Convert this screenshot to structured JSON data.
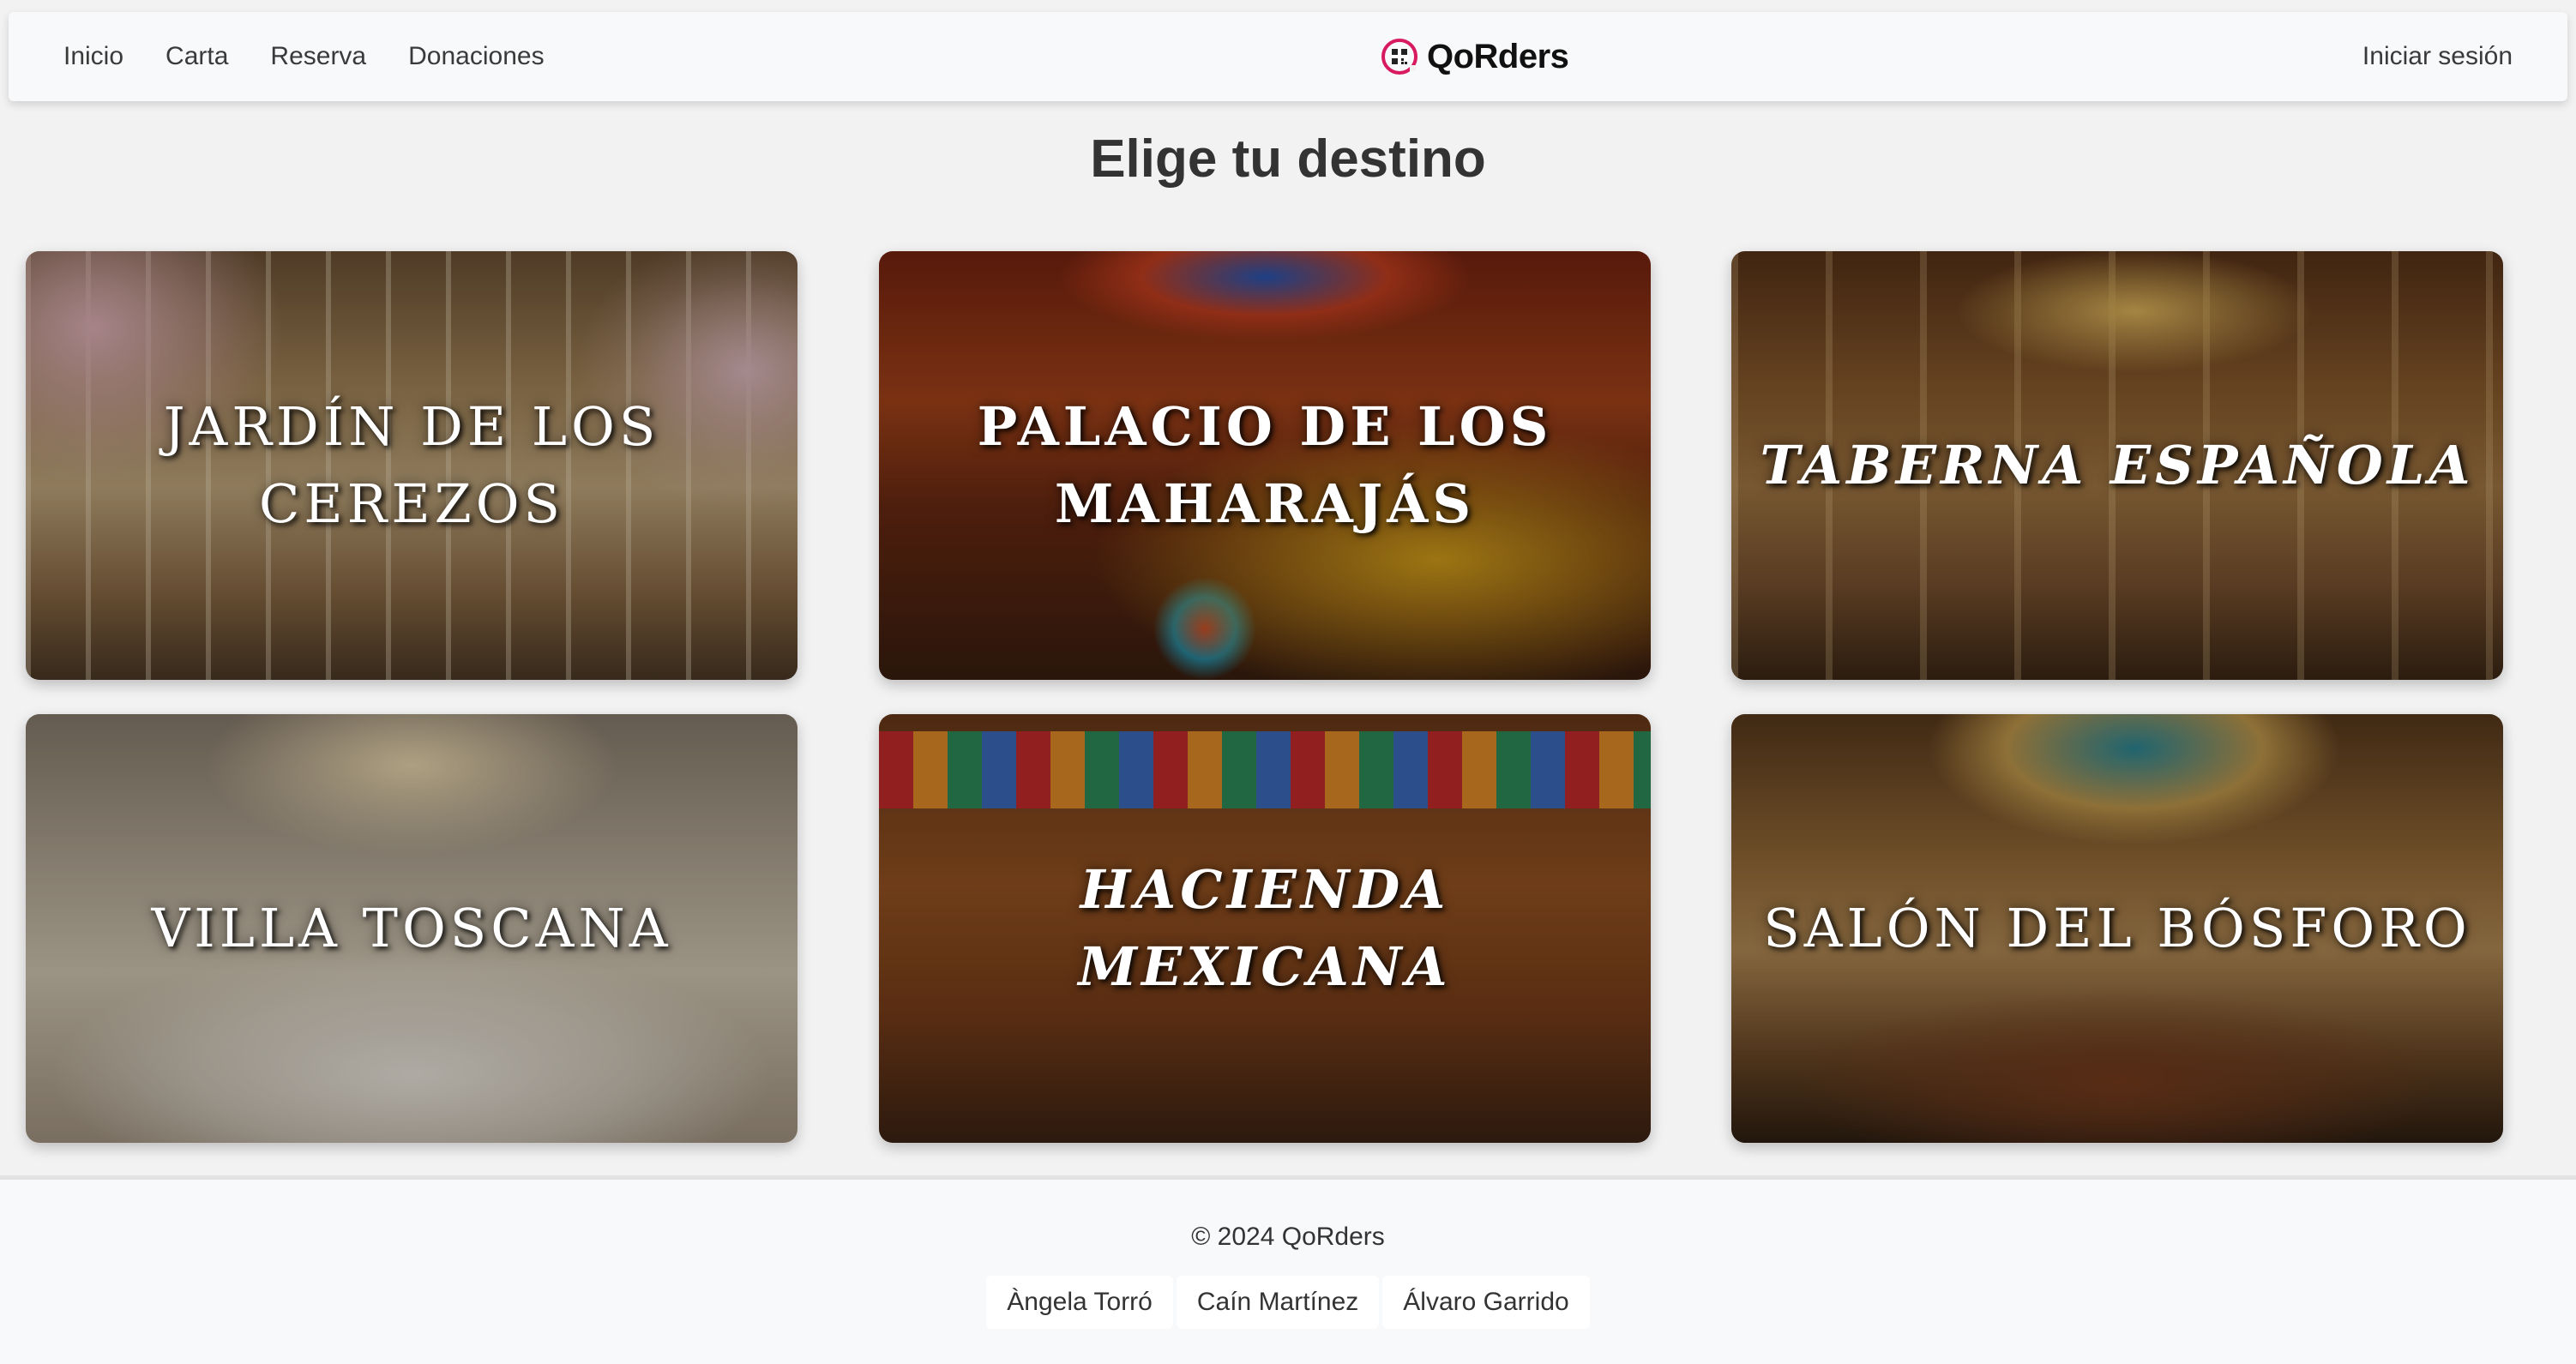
{
  "nav": {
    "links": [
      "Inicio",
      "Carta",
      "Reserva",
      "Donaciones"
    ],
    "brand": "QoRders",
    "login": "Iniciar sesión"
  },
  "page": {
    "title": "Elige tu destino"
  },
  "destinations": [
    {
      "title": "JARDÍN DE LOS CEREZOS"
    },
    {
      "title": "PALACIO DE LOS MAHARAJÁS"
    },
    {
      "title": "TABERNA ESPAÑOLA"
    },
    {
      "title": "VILLA TOSCANA"
    },
    {
      "title": "HACIENDA MEXICANA"
    },
    {
      "title": "SALÓN DEL BÓSFORO"
    }
  ],
  "footer": {
    "copyright": "© 2024 QoRders",
    "authors": [
      "Àngela Torró",
      "Caín Martínez",
      "Álvaro Garrido"
    ]
  },
  "colors": {
    "brand_accent": "#d81b60",
    "navbar_bg": "#f8f9fa",
    "page_bg": "#f2f2f2"
  }
}
